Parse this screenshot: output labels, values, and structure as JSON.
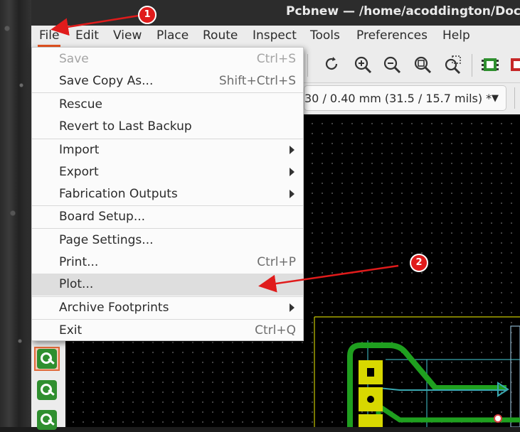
{
  "window": {
    "title": "Pcbnew — /home/acoddington/Docur"
  },
  "menubar": {
    "items": [
      {
        "label": "File",
        "active": true
      },
      {
        "label": "Edit"
      },
      {
        "label": "View"
      },
      {
        "label": "Place"
      },
      {
        "label": "Route"
      },
      {
        "label": "Inspect"
      },
      {
        "label": "Tools"
      },
      {
        "label": "Preferences"
      },
      {
        "label": "Help"
      }
    ]
  },
  "file_menu": {
    "items": [
      {
        "label": "Save",
        "shortcut": "Ctrl+S",
        "disabled": true
      },
      {
        "label": "Save Copy As...",
        "shortcut": "Shift+Ctrl+S"
      },
      {
        "label": "Rescue"
      },
      {
        "label": "Revert to Last Backup"
      },
      {
        "label": "Import",
        "submenu": true
      },
      {
        "label": "Export",
        "submenu": true
      },
      {
        "label": "Fabrication Outputs",
        "submenu": true
      },
      {
        "label": "Board Setup..."
      },
      {
        "label": "Page Settings..."
      },
      {
        "label": "Print...",
        "shortcut": "Ctrl+P"
      },
      {
        "label": "Plot...",
        "highlighted": true
      },
      {
        "label": "Archive Footprints",
        "submenu": true
      },
      {
        "label": "Exit",
        "shortcut": "Ctrl+Q"
      }
    ]
  },
  "toolbar": {
    "track_width": "30 / 0.40 mm (31.5 / 15.7 mils) *",
    "icons": [
      "redo-icon",
      "zoom-in-icon",
      "zoom-out-icon",
      "zoom-fit-icon",
      "zoom-selection-icon",
      "footprint-icon",
      "footprint-red-icon"
    ]
  },
  "annotations": {
    "step1": "1",
    "step2": "2",
    "color": "#e01b1b"
  },
  "colors": {
    "accent": "#e95420",
    "pcb_background": "#000000",
    "track_green": "#1fa01f",
    "pad_yellow": "#d8d800",
    "cyan_outline": "#3aa8b0"
  }
}
